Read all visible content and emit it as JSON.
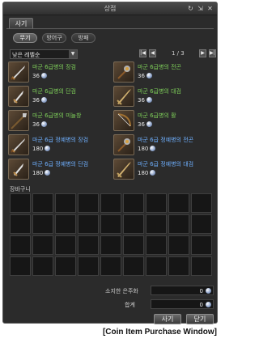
{
  "window": {
    "title": "상점"
  },
  "tabs": {
    "buy": "사기"
  },
  "subtabs": [
    {
      "label": "무기",
      "active": true
    },
    {
      "label": "방어구",
      "active": false
    },
    {
      "label": "방패",
      "active": false
    }
  ],
  "sort": {
    "label": "낮은 레벨순"
  },
  "pager": {
    "text": "1 / 3"
  },
  "items": [
    {
      "name": "마군 6급병의 장검",
      "price": "36",
      "color": "green",
      "icon": "sword-icon"
    },
    {
      "name": "마군 6급병의 전곤",
      "price": "36",
      "color": "green",
      "icon": "mace-icon"
    },
    {
      "name": "마군 6급병의 단검",
      "price": "36",
      "color": "green",
      "icon": "dagger-icon"
    },
    {
      "name": "마군 6급병의 대검",
      "price": "36",
      "color": "green",
      "icon": "greatsword-icon"
    },
    {
      "name": "마군 6급병의 미늘창",
      "price": "36",
      "color": "green",
      "icon": "polearm-icon"
    },
    {
      "name": "마군 6급병의 활",
      "price": "36",
      "color": "green",
      "icon": "bow-icon"
    },
    {
      "name": "마군 6급 정예병의 장검",
      "price": "180",
      "color": "blue",
      "icon": "sword-icon"
    },
    {
      "name": "마군 6급 정예병의 전곤",
      "price": "180",
      "color": "blue",
      "icon": "mace-icon"
    },
    {
      "name": "마군 6급 정예병의 단검",
      "price": "180",
      "color": "blue",
      "icon": "dagger-icon"
    },
    {
      "name": "마군 6급 정예병의 대검",
      "price": "180",
      "color": "blue",
      "icon": "greatsword-icon"
    }
  ],
  "cart": {
    "label": "장바구니"
  },
  "totals": {
    "owned_label": "소지한 은주화",
    "owned_value": "0",
    "sum_label": "합계",
    "sum_value": "0"
  },
  "buttons": {
    "buy": "사기",
    "close": "닫기"
  },
  "caption": "[Coin Item Purchase Window]",
  "colors": {
    "name_green": "#7fd15a",
    "name_blue": "#6fb0ff",
    "window_bg": "#2b2b2b"
  }
}
